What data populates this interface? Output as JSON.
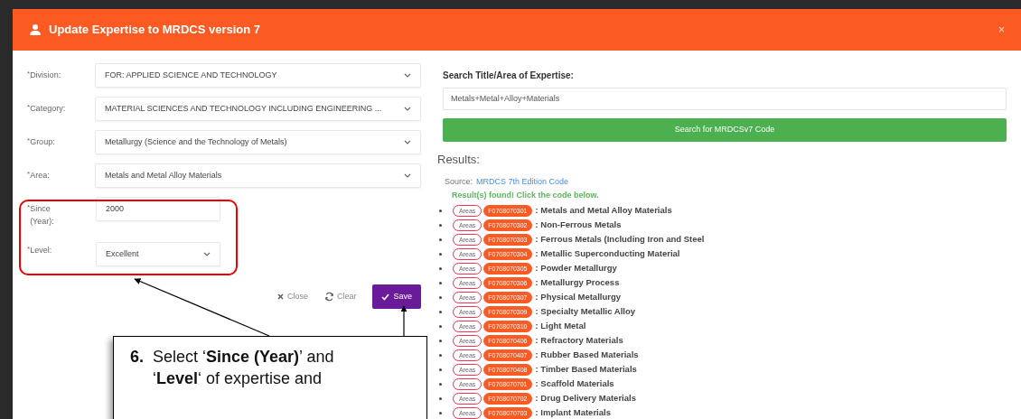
{
  "dialog": {
    "title": "Update Expertise to MRDCS version 7",
    "close": "×"
  },
  "form": {
    "fields": [
      {
        "label": "Division:",
        "kind": "select",
        "value": "FOR: APPLIED SCIENCE AND TECHNOLOGY",
        "required_mark": "*"
      },
      {
        "label": "Category:",
        "kind": "select",
        "value": "MATERIAL SCIENCES AND TECHNOLOGY INCLUDING ENGINEERING ...",
        "required_mark": "*"
      },
      {
        "label": "Group:",
        "kind": "select",
        "value": "Metallurgy (Science and the Technology of Metals)",
        "required_mark": "*"
      },
      {
        "label": "Area:",
        "kind": "select",
        "value": "Metals and Metal Alloy Materials",
        "required_mark": "*"
      },
      {
        "label": "Since (Year):",
        "kind": "input",
        "value": "2000",
        "required_mark": "*"
      },
      {
        "label": "Level:",
        "kind": "select",
        "value": "Excellent",
        "required_mark": "*"
      }
    ],
    "buttons": [
      {
        "label": "Close",
        "kind": "close"
      },
      {
        "label": "Clear",
        "kind": "clear"
      },
      {
        "label": "Save",
        "kind": "save"
      }
    ]
  },
  "search": {
    "label": "Search Title/Area of Expertise:",
    "value": "Metals+Metal+Alloy+Materials",
    "button": "Search for MRDCSv7 Code"
  },
  "results": {
    "heading": "Results:",
    "source_label": "Source:",
    "source_link": "MRDCS 7th Edition Code",
    "message": "Result(s) found! Click the code below.",
    "items": [
      {
        "tag": "Areas",
        "code": "F0708070301",
        "title": ": Metals and Metal Alloy Materials"
      },
      {
        "tag": "Areas",
        "code": "F0708070302",
        "title": ": Non-Ferrous Metals"
      },
      {
        "tag": "Areas",
        "code": "F0708070303",
        "title": ": Ferrous Metals (Including Iron and Steel"
      },
      {
        "tag": "Areas",
        "code": "F0708070304",
        "title": ": Metallic Superconducting Material"
      },
      {
        "tag": "Areas",
        "code": "F0708070305",
        "title": ": Powder Metallurgy"
      },
      {
        "tag": "Areas",
        "code": "F0708070306",
        "title": ": Metallurgy Process"
      },
      {
        "tag": "Areas",
        "code": "F0708070307",
        "title": ": Physical Metallurgy"
      },
      {
        "tag": "Areas",
        "code": "F0708070309",
        "title": ": Specialty Metallic Alloy"
      },
      {
        "tag": "Areas",
        "code": "F0708070310",
        "title": ": Light Metal"
      },
      {
        "tag": "Areas",
        "code": "F0708070406",
        "title": ": Refractory Materials"
      },
      {
        "tag": "Areas",
        "code": "F0708070407",
        "title": ": Rubber Based Materials"
      },
      {
        "tag": "Areas",
        "code": "F0708070408",
        "title": ": Timber Based Materials"
      },
      {
        "tag": "Areas",
        "code": "F0708070701",
        "title": ": Scaffold Materials"
      },
      {
        "tag": "Areas",
        "code": "F0708070702",
        "title": ": Drug Delivery Materials"
      },
      {
        "tag": "Areas",
        "code": "F0708070703",
        "title": ": Implant Materials"
      }
    ]
  },
  "callout": {
    "number": "6.",
    "lines": [
      "Select ‘**Since (Year)**’ and",
      "‘**Level**‘ of expertise and"
    ]
  }
}
